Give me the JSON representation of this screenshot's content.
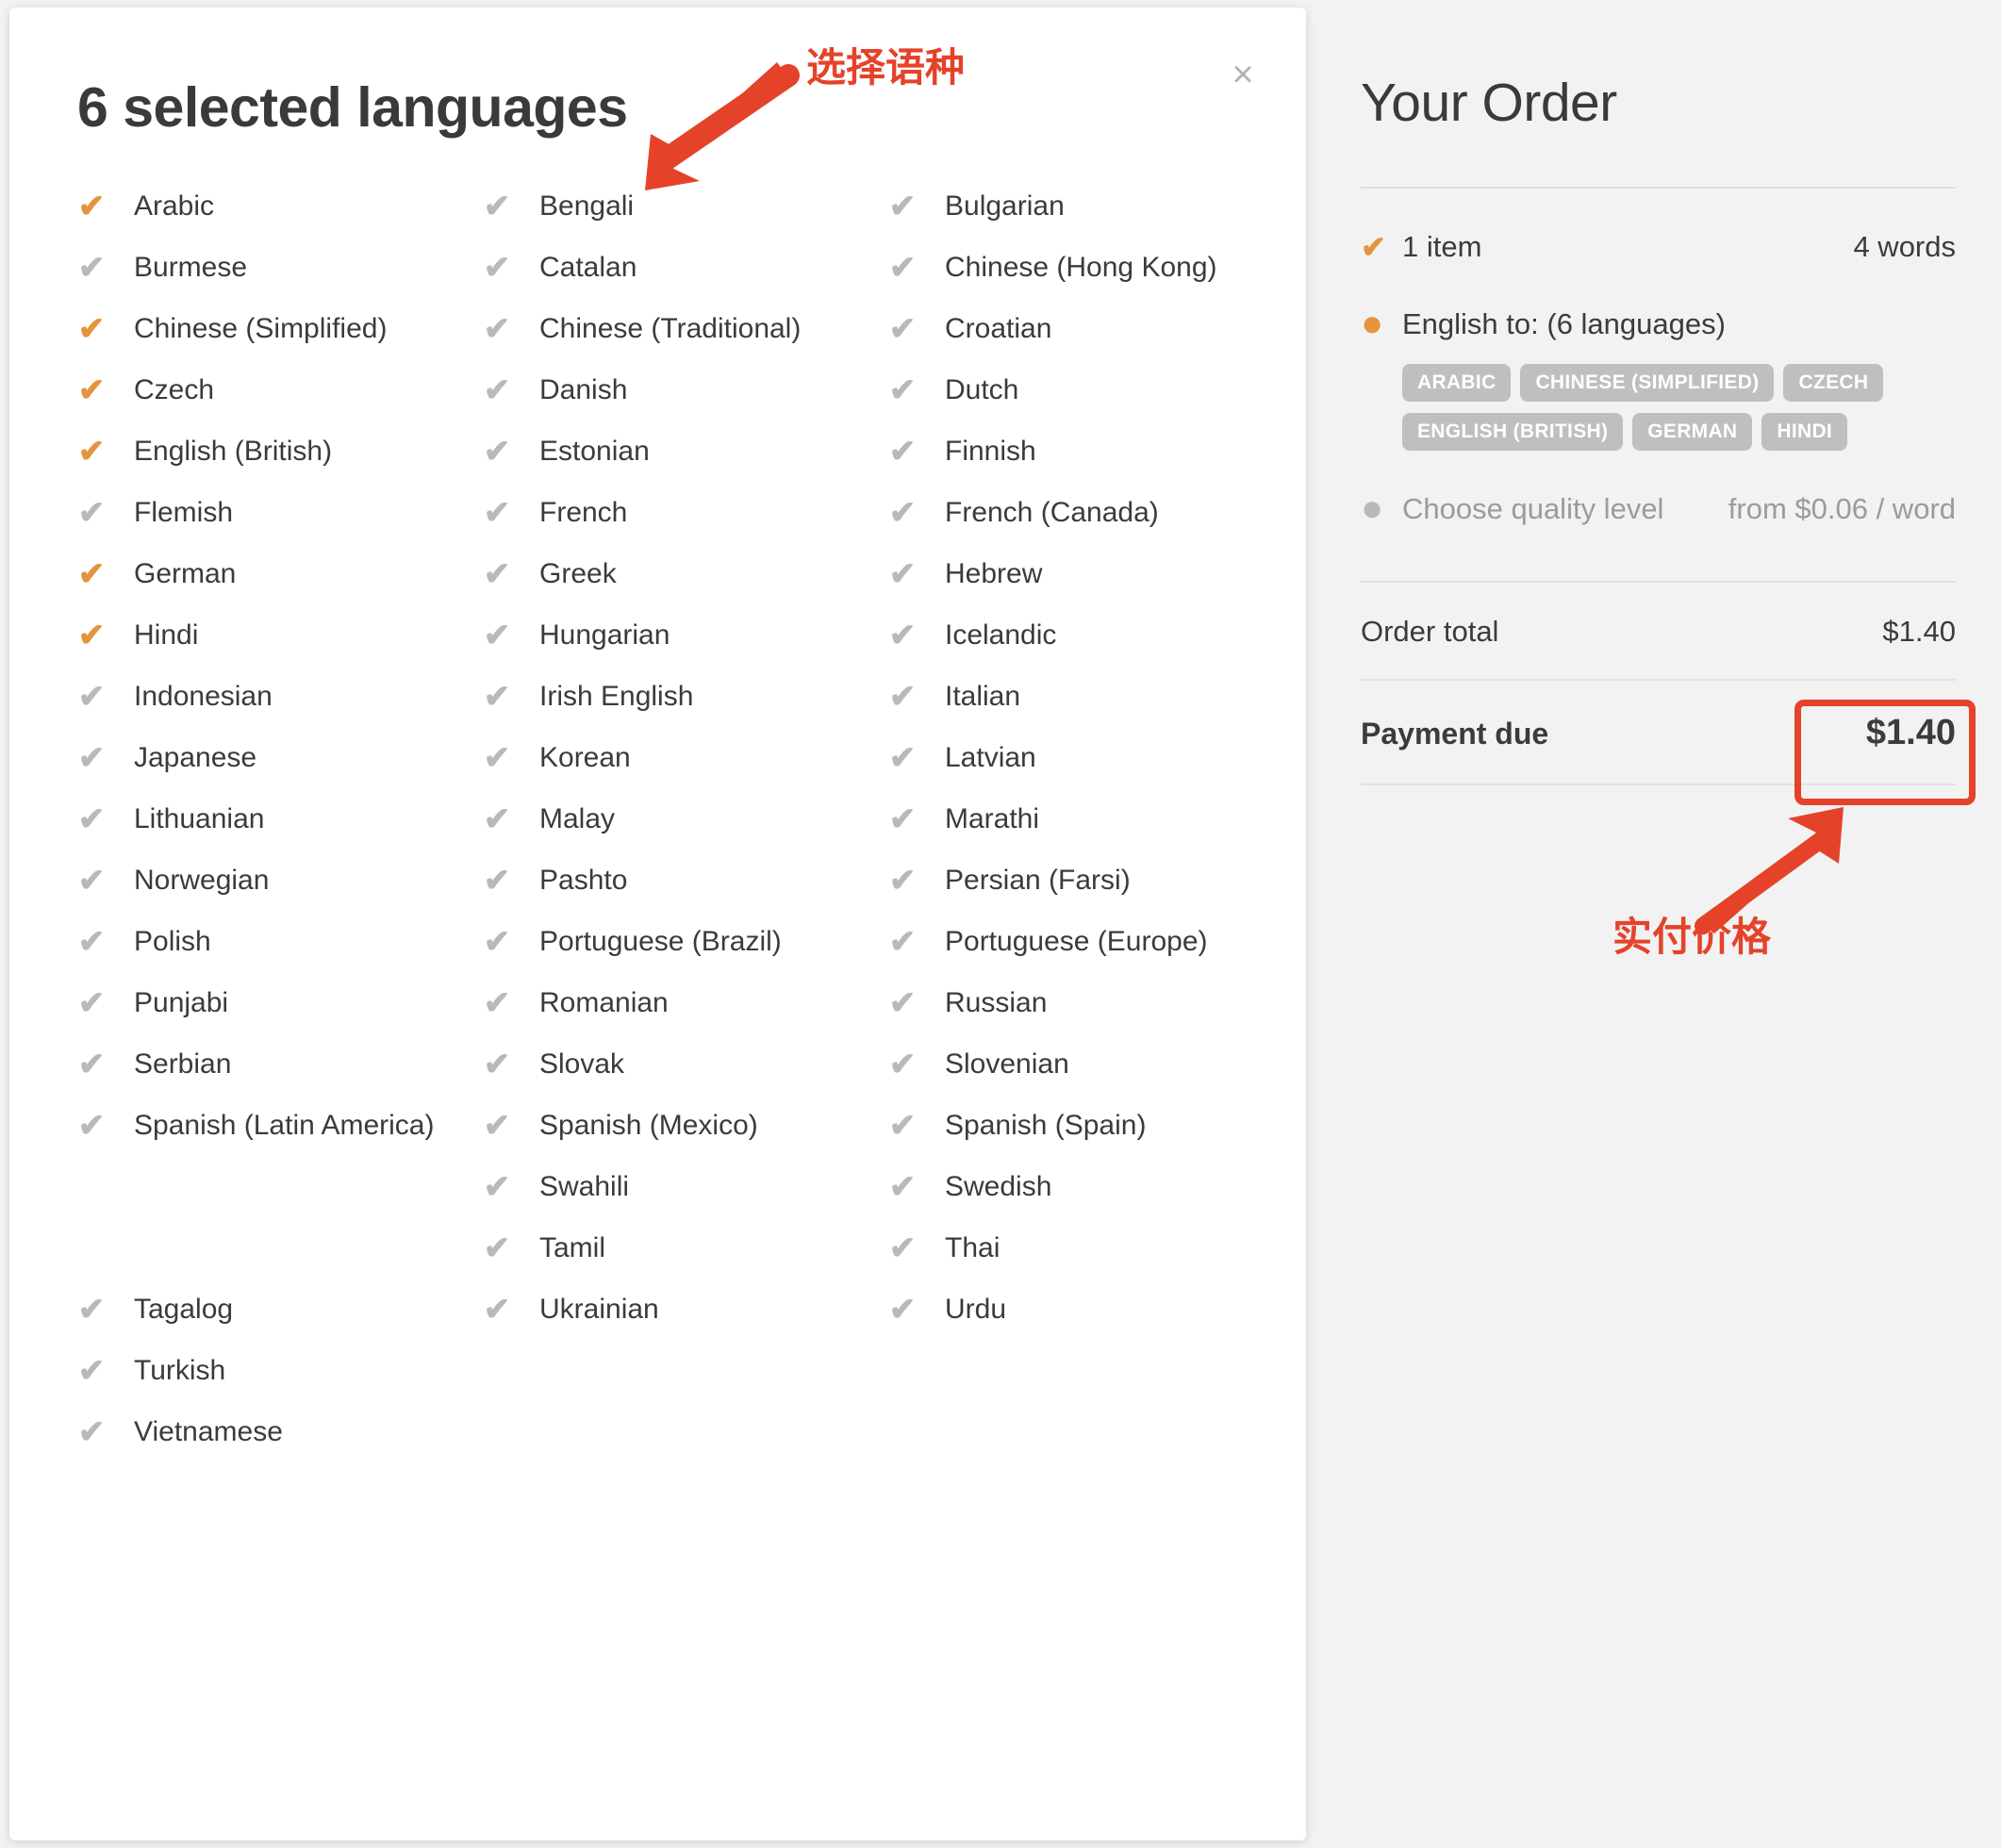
{
  "modal": {
    "title": "6 selected languages",
    "close_icon": "close-icon",
    "close_label": "×",
    "check_glyph": "✔",
    "languages": [
      {
        "name": "Arabic",
        "selected": true
      },
      {
        "name": "Bengali",
        "selected": false
      },
      {
        "name": "Bulgarian",
        "selected": false
      },
      {
        "name": "Burmese",
        "selected": false
      },
      {
        "name": "Catalan",
        "selected": false
      },
      {
        "name": "Chinese (Hong Kong)",
        "selected": false
      },
      {
        "name": "Chinese (Simplified)",
        "selected": true
      },
      {
        "name": "Chinese (Traditional)",
        "selected": false
      },
      {
        "name": "Croatian",
        "selected": false
      },
      {
        "name": "Czech",
        "selected": true
      },
      {
        "name": "Danish",
        "selected": false
      },
      {
        "name": "Dutch",
        "selected": false
      },
      {
        "name": "English (British)",
        "selected": true
      },
      {
        "name": "Estonian",
        "selected": false
      },
      {
        "name": "Finnish",
        "selected": false
      },
      {
        "name": "Flemish",
        "selected": false
      },
      {
        "name": "French",
        "selected": false
      },
      {
        "name": "French (Canada)",
        "selected": false
      },
      {
        "name": "German",
        "selected": true
      },
      {
        "name": "Greek",
        "selected": false
      },
      {
        "name": "Hebrew",
        "selected": false
      },
      {
        "name": "Hindi",
        "selected": true
      },
      {
        "name": "Hungarian",
        "selected": false
      },
      {
        "name": "Icelandic",
        "selected": false
      },
      {
        "name": "Indonesian",
        "selected": false
      },
      {
        "name": "Irish English",
        "selected": false
      },
      {
        "name": "Italian",
        "selected": false
      },
      {
        "name": "Japanese",
        "selected": false
      },
      {
        "name": "Korean",
        "selected": false
      },
      {
        "name": "Latvian",
        "selected": false
      },
      {
        "name": "Lithuanian",
        "selected": false
      },
      {
        "name": "Malay",
        "selected": false
      },
      {
        "name": "Marathi",
        "selected": false
      },
      {
        "name": "Norwegian",
        "selected": false
      },
      {
        "name": "Pashto",
        "selected": false
      },
      {
        "name": "Persian (Farsi)",
        "selected": false
      },
      {
        "name": "Polish",
        "selected": false
      },
      {
        "name": "Portuguese (Brazil)",
        "selected": false
      },
      {
        "name": "Portuguese (Europe)",
        "selected": false
      },
      {
        "name": "Punjabi",
        "selected": false
      },
      {
        "name": "Romanian",
        "selected": false
      },
      {
        "name": "Russian",
        "selected": false
      },
      {
        "name": "Serbian",
        "selected": false
      },
      {
        "name": "Slovak",
        "selected": false
      },
      {
        "name": "Slovenian",
        "selected": false
      },
      {
        "name": "Spanish (Latin America)",
        "selected": false,
        "tall": true
      },
      {
        "name": "Spanish (Mexico)",
        "selected": false
      },
      {
        "name": "Spanish (Spain)",
        "selected": false
      },
      {
        "name": "",
        "selected": false,
        "spacer": true
      },
      {
        "name": "Swahili",
        "selected": false
      },
      {
        "name": "Swedish",
        "selected": false
      },
      {
        "name": "Tagalog",
        "selected": false
      },
      {
        "name": "Tamil",
        "selected": false
      },
      {
        "name": "Thai",
        "selected": false
      },
      {
        "name": "Turkish",
        "selected": false
      },
      {
        "name": "Ukrainian",
        "selected": false
      },
      {
        "name": "Urdu",
        "selected": false
      },
      {
        "name": "Vietnamese",
        "selected": false
      }
    ]
  },
  "order": {
    "title": "Your Order",
    "item_count_label": "1 item",
    "word_count_label": "4 words",
    "languages_label": "English to: (6 languages)",
    "selected_tags": [
      "ARABIC",
      "CHINESE (SIMPLIFIED)",
      "CZECH",
      "ENGLISH (BRITISH)",
      "GERMAN",
      "HINDI"
    ],
    "quality_label": "Choose quality level",
    "quality_price": "from $0.06 / word",
    "order_total_label": "Order total",
    "order_total_value": "$1.40",
    "payment_due_label": "Payment due",
    "payment_due_value": "$1.40",
    "check_glyph": "✔",
    "dot_glyph": "●"
  },
  "annotations": {
    "language_note": "选择语种",
    "price_note": "实付价格",
    "accent_red": "#e4432a",
    "accent_orange": "#e4943c",
    "tag_grey": "#bfbfbf"
  }
}
